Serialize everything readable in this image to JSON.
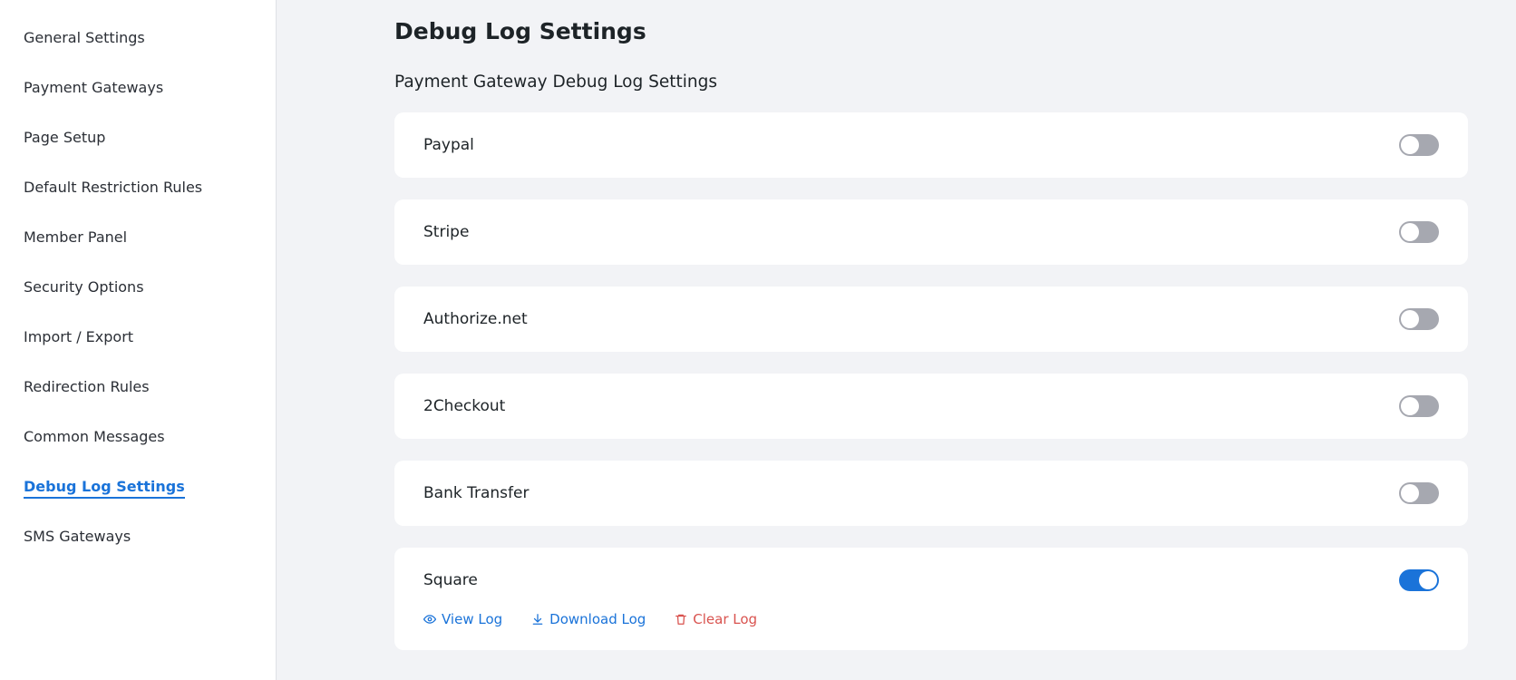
{
  "sidebar": {
    "items": [
      {
        "label": "General Settings"
      },
      {
        "label": "Payment Gateways"
      },
      {
        "label": "Page Setup"
      },
      {
        "label": "Default Restriction Rules"
      },
      {
        "label": "Member Panel"
      },
      {
        "label": "Security Options"
      },
      {
        "label": "Import / Export"
      },
      {
        "label": "Redirection Rules"
      },
      {
        "label": "Common Messages"
      },
      {
        "label": "Debug Log Settings",
        "active": true
      },
      {
        "label": "SMS Gateways"
      }
    ]
  },
  "main": {
    "title": "Debug Log Settings",
    "section_title": "Payment Gateway Debug Log Settings",
    "gateways": [
      {
        "label": "Paypal",
        "enabled": false
      },
      {
        "label": "Stripe",
        "enabled": false
      },
      {
        "label": "Authorize.net",
        "enabled": false
      },
      {
        "label": "2Checkout",
        "enabled": false
      },
      {
        "label": "Bank Transfer",
        "enabled": false
      },
      {
        "label": "Square",
        "enabled": true
      }
    ],
    "square_actions": {
      "view_log": "View Log",
      "download_log": "Download Log",
      "clear_log": "Clear Log"
    }
  },
  "icons": {
    "view": "eye-icon",
    "download": "download-icon",
    "clear": "trash-icon"
  },
  "colors": {
    "accent": "#1a73d9",
    "danger": "#d9534f",
    "toggle_off": "#a6a8b0",
    "background": "#f2f3f6"
  }
}
